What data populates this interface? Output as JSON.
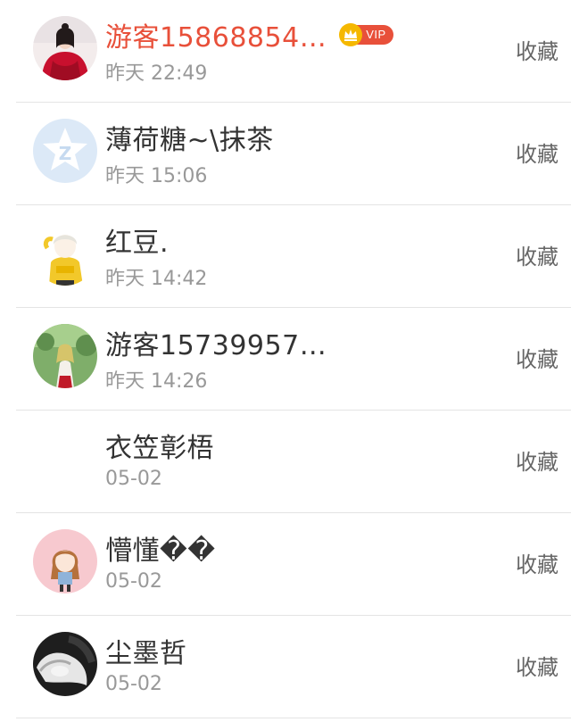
{
  "items": [
    {
      "name": "游客15868854…",
      "time": "昨天 22:49",
      "action": "收藏",
      "vip": true,
      "vip_label": "VIP",
      "name_color": "#e8503a"
    },
    {
      "name": "薄荷糖~\\抹茶",
      "time": "昨天 15:06",
      "action": "收藏",
      "vip": false
    },
    {
      "name": "红豆.",
      "time": "昨天 14:42",
      "action": "收藏",
      "vip": false
    },
    {
      "name": "游客15739957…",
      "time": "昨天 14:26",
      "action": "收藏",
      "vip": false
    },
    {
      "name": "衣笠彰梧",
      "time": "05-02",
      "action": "收藏",
      "vip": false
    },
    {
      "name": "懵懂��",
      "time": "05-02",
      "action": "收藏",
      "vip": false
    },
    {
      "name": "尘墨哲",
      "time": "05-02",
      "action": "收藏",
      "vip": false
    }
  ],
  "colors": {
    "vip_accent": "#e8503a",
    "crown": "#f5b800",
    "text_primary": "#333333",
    "text_secondary": "#999999",
    "divider": "#e4e4e4"
  }
}
